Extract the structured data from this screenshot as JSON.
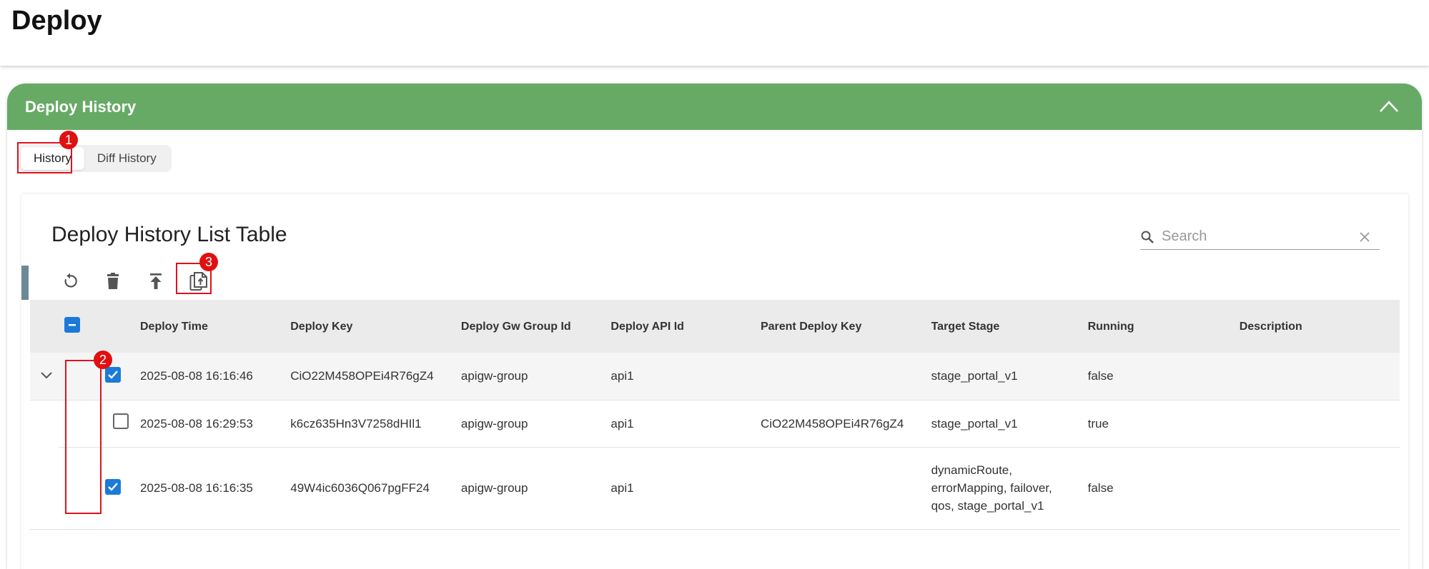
{
  "page": {
    "title": "Deploy"
  },
  "card": {
    "title": "Deploy History"
  },
  "tabs": [
    {
      "label": "History",
      "active": true
    },
    {
      "label": "Diff History",
      "active": false
    }
  ],
  "annotations": [
    "1",
    "2",
    "3"
  ],
  "table": {
    "title": "Deploy History List Table",
    "search_placeholder": "Search",
    "toolbar_icons": [
      "refresh-icon",
      "delete-icon",
      "upload-icon",
      "export-document-icon"
    ],
    "columns": [
      "Deploy Time",
      "Deploy Key",
      "Deploy Gw Group Id",
      "Deploy API Id",
      "Parent Deploy Key",
      "Target Stage",
      "Running",
      "Description"
    ],
    "rows": [
      {
        "checked": true,
        "expandable": true,
        "deploy_time": "2025-08-08 16:16:46",
        "deploy_key": "CiO22M458OPEi4R76gZ4",
        "gw_group_id": "apigw-group",
        "api_id": "api1",
        "parent_key": "",
        "target_stage": "stage_portal_v1",
        "running": "false",
        "description": ""
      },
      {
        "checked": false,
        "expandable": false,
        "deploy_time": "2025-08-08 16:29:53",
        "deploy_key": "k6cz635Hn3V7258dHIl1",
        "gw_group_id": "apigw-group",
        "api_id": "api1",
        "parent_key": "CiO22M458OPEi4R76gZ4",
        "target_stage": "stage_portal_v1",
        "running": "true",
        "description": ""
      },
      {
        "checked": true,
        "expandable": false,
        "deploy_time": "2025-08-08 16:16:35",
        "deploy_key": "49W4ic6036Q067pgFF24",
        "gw_group_id": "apigw-group",
        "api_id": "api1",
        "parent_key": "",
        "target_stage": "dynamicRoute, errorMapping, failover, qos, stage_portal_v1",
        "running": "false",
        "description": ""
      }
    ]
  },
  "colors": {
    "header_green": "#67aa66",
    "checkbox_blue": "#1b7ad8",
    "annotation_red": "#e01010"
  }
}
